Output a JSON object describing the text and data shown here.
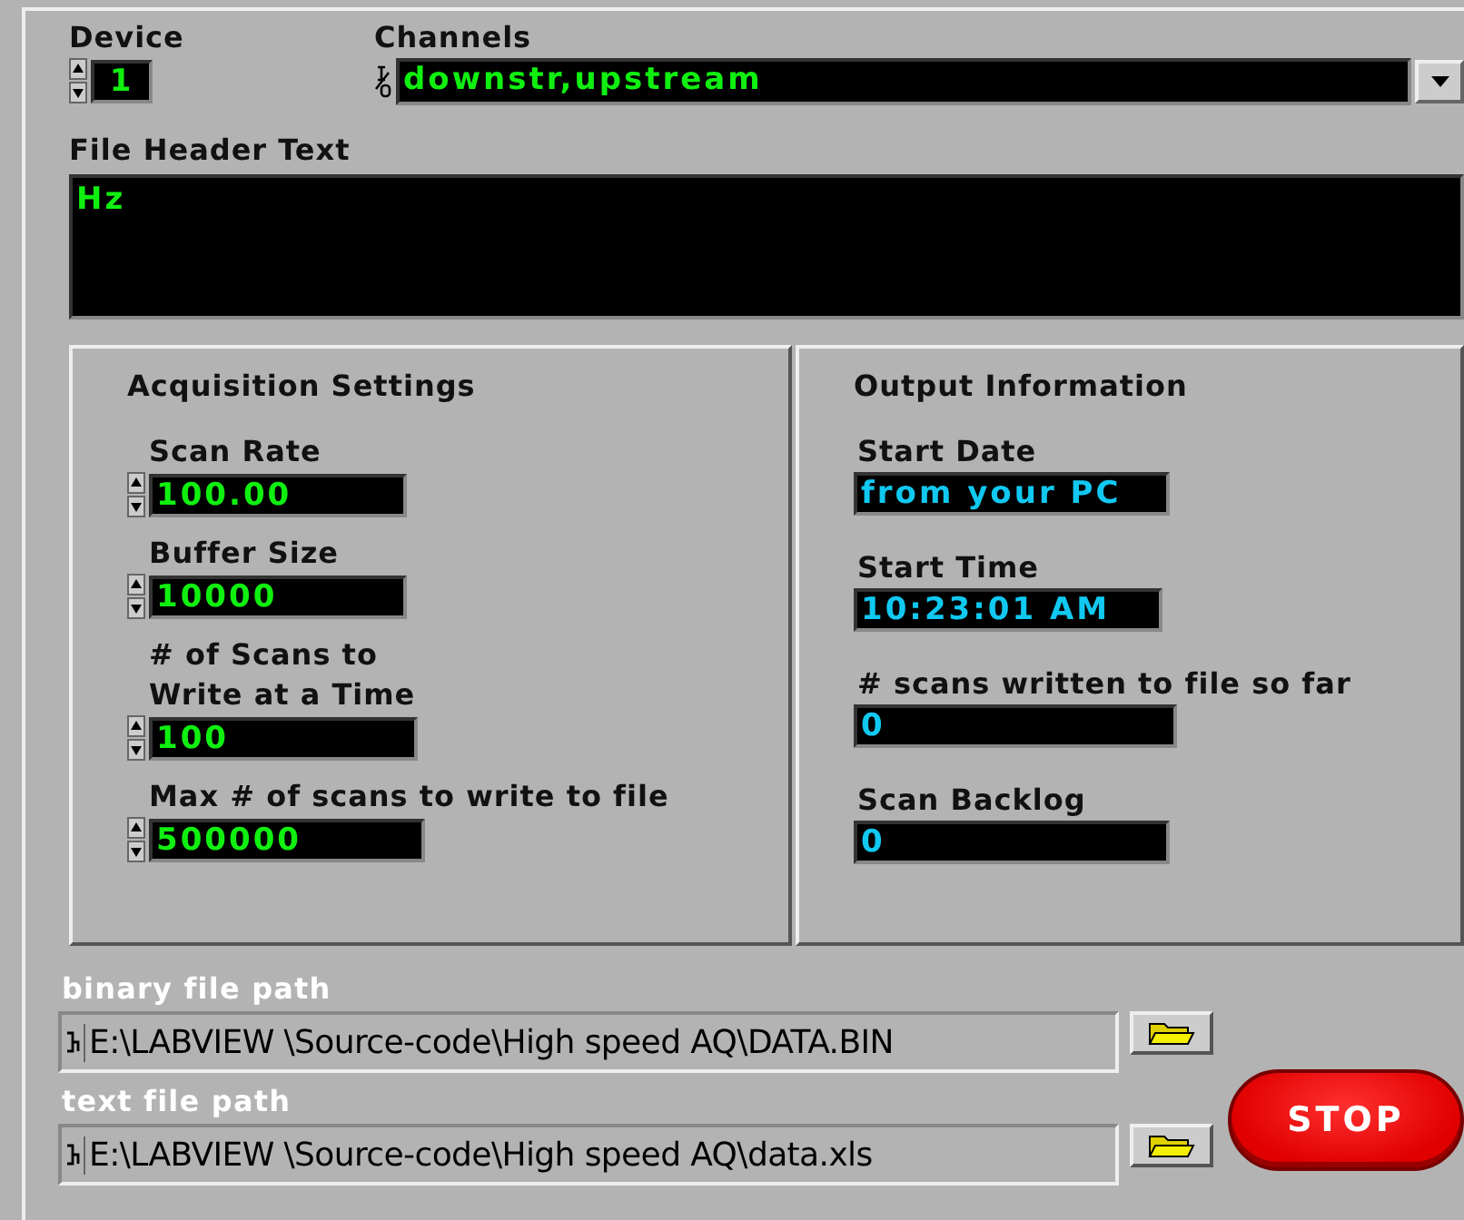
{
  "device": {
    "label": "Device",
    "value": "1"
  },
  "channels": {
    "label": "Channels",
    "value": "downstr,upstream"
  },
  "file_header": {
    "label": "File Header Text",
    "value": "Hz"
  },
  "acquisition": {
    "title": "Acquisition Settings",
    "fields": [
      {
        "label": "Scan Rate",
        "value": "100.00"
      },
      {
        "label": "Buffer Size",
        "value": "10000"
      },
      {
        "label": "# of Scans to\nWrite at a Time",
        "value": "100"
      },
      {
        "label": "Max # of scans to write to file",
        "value": "500000"
      }
    ]
  },
  "output": {
    "title": "Output Information",
    "fields": [
      {
        "label": "Start Date",
        "value": "from your PC"
      },
      {
        "label": "Start Time",
        "value": "10:23:01 AM"
      },
      {
        "label": "# scans written to file so far",
        "value": "0"
      },
      {
        "label": "Scan Backlog",
        "value": "0"
      }
    ]
  },
  "paths": [
    {
      "label": "binary file path",
      "value": "E:\\LABVIEW \\Source-code\\High speed AQ\\DATA.BIN"
    },
    {
      "label": "text file path",
      "value": "E:\\LABVIEW \\Source-code\\High speed AQ\\data.xls"
    }
  ],
  "stop_button": {
    "label": "STOP"
  }
}
